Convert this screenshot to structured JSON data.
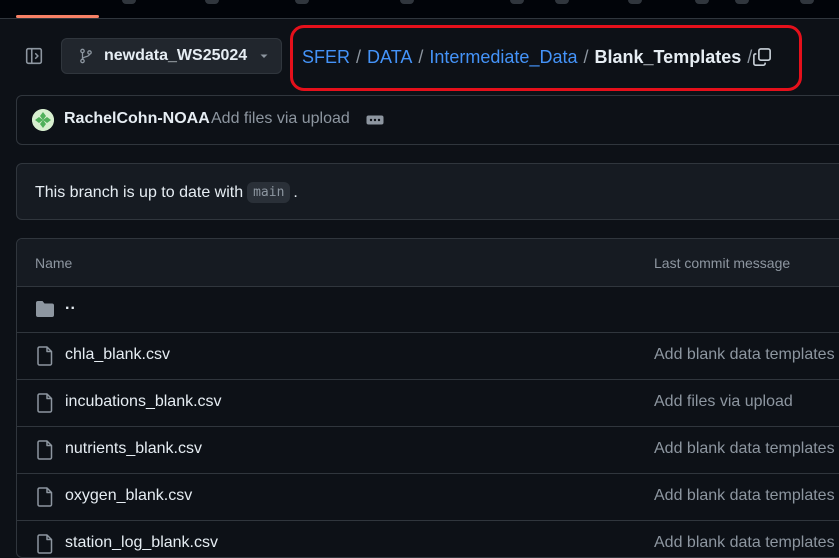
{
  "header": {
    "branch": "newdata_WS25024",
    "breadcrumb": [
      {
        "label": "SFER"
      },
      {
        "label": "DATA"
      },
      {
        "label": "Intermediate_Data"
      },
      {
        "label": "Blank_Templates"
      }
    ],
    "separator": "/",
    "trailing_separator": "/"
  },
  "commit": {
    "author": "RachelCohn-NOAA",
    "message": "Add files via upload"
  },
  "status": {
    "text_before": "This branch is up to date with",
    "branch": "main",
    "text_after": "."
  },
  "table": {
    "columns": {
      "name": "Name",
      "last_commit": "Last commit message"
    },
    "rows": [
      {
        "type": "folder",
        "name": "..",
        "commit_message": ""
      },
      {
        "type": "file",
        "name": "chla_blank.csv",
        "commit_message": "Add blank data templates"
      },
      {
        "type": "file",
        "name": "incubations_blank.csv",
        "commit_message": "Add files via upload"
      },
      {
        "type": "file",
        "name": "nutrients_blank.csv",
        "commit_message": "Add blank data templates"
      },
      {
        "type": "file",
        "name": "oxygen_blank.csv",
        "commit_message": "Add blank data templates"
      },
      {
        "type": "file",
        "name": "station_log_blank.csv",
        "commit_message": "Add blank data templates"
      }
    ]
  },
  "colors": {
    "background": "#0d1117",
    "link": "#4493f8",
    "muted": "#8d96a0",
    "border": "#30363d",
    "highlight": "#e5101b"
  },
  "icons": {
    "sidebar": "sidebar-collapse-icon",
    "branch": "git-branch-icon",
    "dropdown": "triangle-down-icon",
    "copy": "copy-icon",
    "ellipsis": "kebab-horizontal-icon",
    "folder": "folder-icon",
    "file": "file-icon"
  }
}
